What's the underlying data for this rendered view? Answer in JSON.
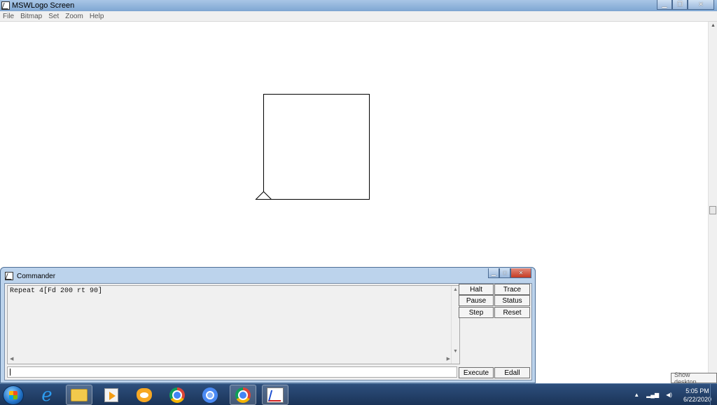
{
  "window": {
    "title": "MSWLogo Screen",
    "menu": [
      "File",
      "Bitmap",
      "Set",
      "Zoom",
      "Help"
    ]
  },
  "commander": {
    "title": "Commander",
    "history": [
      "Repeat 4[Fd 200 rt 90]"
    ],
    "input_value": "",
    "buttons": {
      "halt": "Halt",
      "trace": "Trace",
      "pause": "Pause",
      "status": "Status",
      "step": "Step",
      "reset": "Reset",
      "execute": "Execute",
      "edall": "Edall"
    }
  },
  "taskbar": {
    "apps": [
      "windows-start",
      "internet-explorer",
      "file-explorer",
      "media-player",
      "scratch",
      "google-chrome",
      "chromium",
      "chrome-active",
      "mswlogo"
    ],
    "tooltip": "Show desktop",
    "time": "5:05 PM",
    "date": "6/22/2020"
  }
}
